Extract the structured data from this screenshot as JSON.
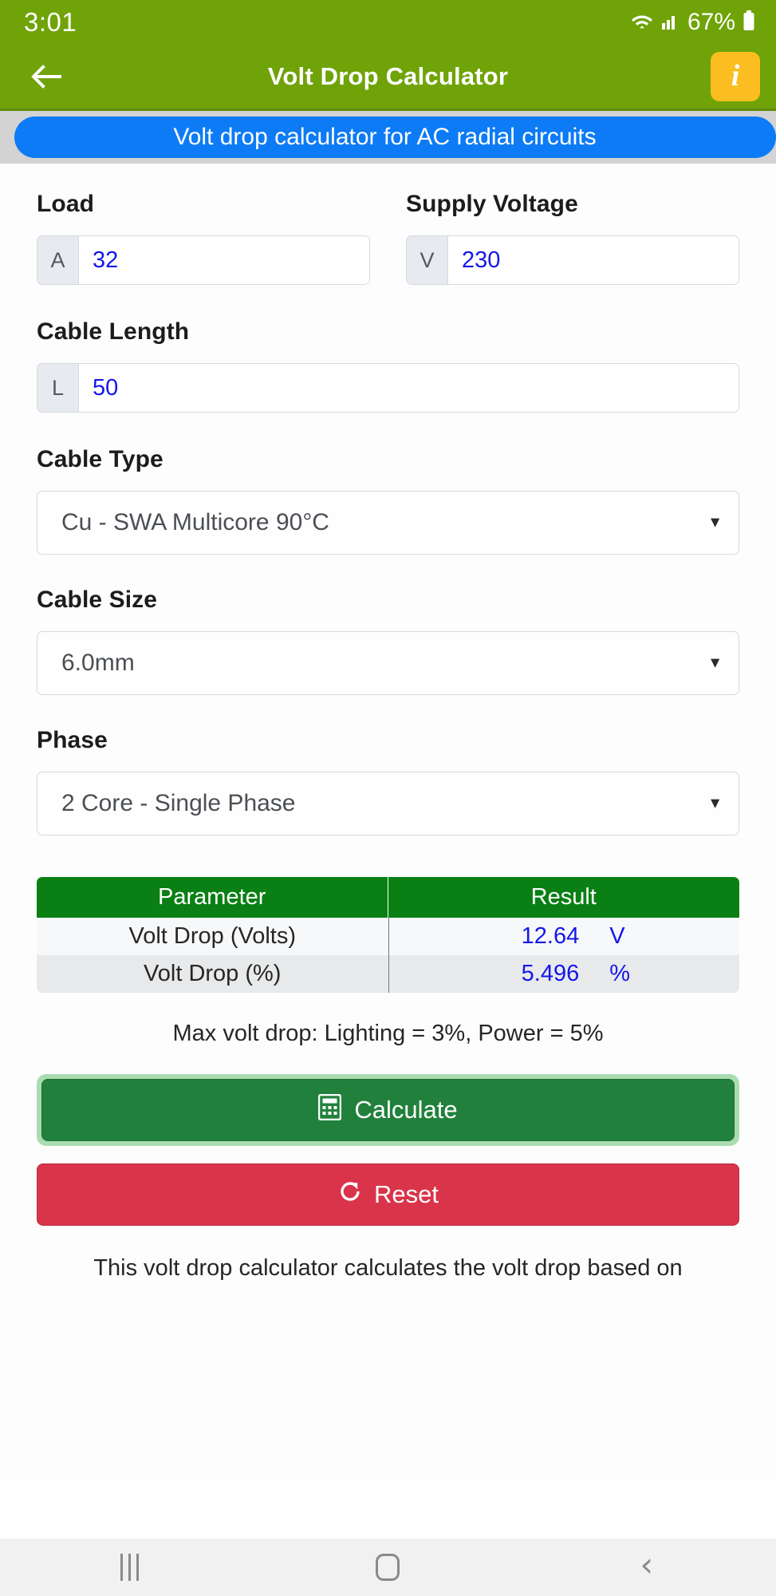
{
  "status_bar": {
    "time": "3:01",
    "battery": "67%",
    "wifi_icon": "wifi-icon",
    "signal_icon": "cellular-signal-icon",
    "battery_icon": "battery-icon"
  },
  "app_bar": {
    "back_icon": "back-arrow-icon",
    "title": "Volt Drop Calculator",
    "info_label": "i",
    "info_icon": "info-icon"
  },
  "banner": {
    "text": "Volt drop calculator for AC radial circuits"
  },
  "form": {
    "load": {
      "label": "Load",
      "prefix": "A",
      "value": "32"
    },
    "supply_voltage": {
      "label": "Supply Voltage",
      "prefix": "V",
      "value": "230"
    },
    "cable_length": {
      "label": "Cable Length",
      "prefix": "L",
      "value": "50"
    },
    "cable_type": {
      "label": "Cable Type",
      "value": "Cu - SWA Multicore 90°C",
      "arrow": "▼"
    },
    "cable_size": {
      "label": "Cable Size",
      "value": "6.0mm",
      "arrow": "▼"
    },
    "phase": {
      "label": "Phase",
      "value": "2 Core - Single Phase",
      "arrow": "▼"
    }
  },
  "results": {
    "headers": {
      "parameter": "Parameter",
      "result": "Result"
    },
    "rows": [
      {
        "parameter": "Volt Drop (Volts)",
        "value": "12.64",
        "unit": "V"
      },
      {
        "parameter": "Volt Drop (%)",
        "value": "5.496",
        "unit": "%"
      }
    ],
    "note": "Max volt drop: Lighting = 3%, Power = 5%"
  },
  "actions": {
    "calculate_label": "Calculate",
    "calculate_icon": "calculator-icon",
    "reset_label": "Reset",
    "reset_icon": "refresh-icon"
  },
  "description": {
    "text": "This volt drop calculator calculates the volt drop based on"
  },
  "nav_bar": {
    "recents_icon": "recents-icon",
    "home_icon": "home-icon",
    "back_icon": "back-chevron-icon"
  },
  "colors": {
    "app_bar_green": "#6fa308",
    "banner_blue": "#0d7bf5",
    "info_amber": "#fbbd1f",
    "table_header_green": "#0a8014",
    "calculate_green": "#21813c",
    "reset_red": "#d9344a",
    "value_blue": "#1417e8"
  }
}
